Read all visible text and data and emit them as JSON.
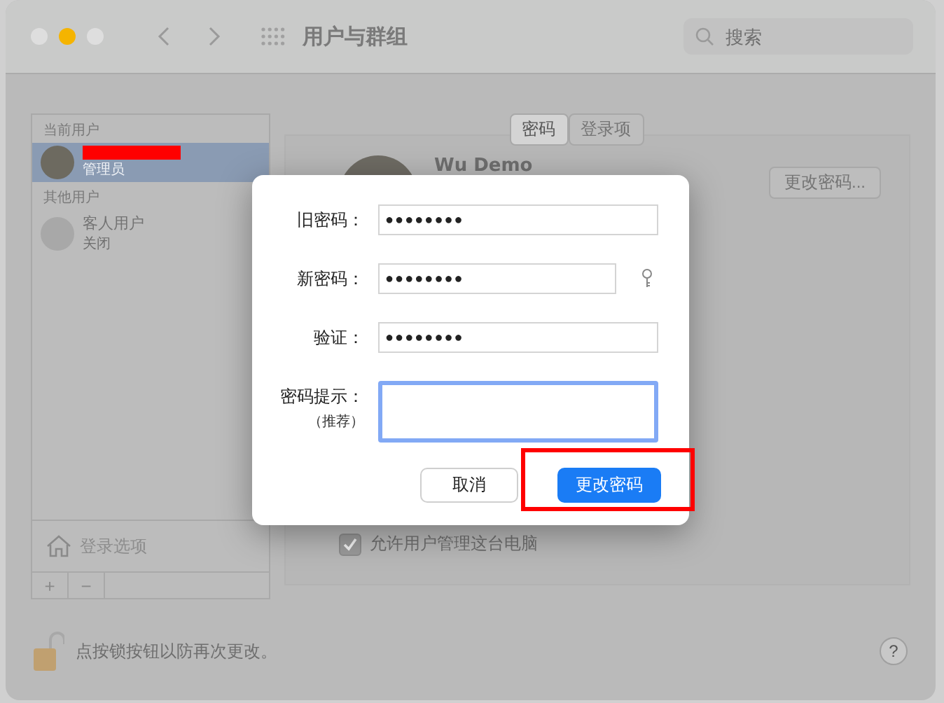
{
  "window": {
    "title": "用户与群组"
  },
  "search": {
    "placeholder": "搜索"
  },
  "sidebar": {
    "sections": [
      {
        "header": "当前用户",
        "users": [
          {
            "kind": "redacted",
            "role": "管理员",
            "selected": true
          }
        ]
      },
      {
        "header": "其他用户",
        "users": [
          {
            "kind": "guest",
            "name": "客人用户",
            "role": "关闭",
            "selected": false
          }
        ]
      }
    ],
    "login_options": "登录选项",
    "add": "+",
    "remove": "−"
  },
  "tabs": [
    {
      "label": "密码",
      "selected": true
    },
    {
      "label": "登录项",
      "selected": false
    }
  ],
  "user_name": "Wu Demo",
  "change_password_button": "更改密码...",
  "admin_checkbox": {
    "label": "允许用户管理这台电脑",
    "checked": true
  },
  "lock_text": "点按锁按钮以防再次更改。",
  "help": "?",
  "dialog": {
    "fields": [
      {
        "kind": "password",
        "label": "旧密码：",
        "value": "●●●●●●●●"
      },
      {
        "kind": "new_password",
        "label": "新密码：",
        "value": "●●●●●●●●"
      },
      {
        "kind": "password",
        "label": "验证：",
        "value": "●●●●●●●●"
      },
      {
        "kind": "hint",
        "label": "密码提示：",
        "sublabel": "（推荐）",
        "focused": true
      }
    ],
    "buttons": [
      {
        "label": "取消",
        "kind": "cancel"
      },
      {
        "label": "更改密码",
        "kind": "primary",
        "highlighted": true
      }
    ]
  }
}
